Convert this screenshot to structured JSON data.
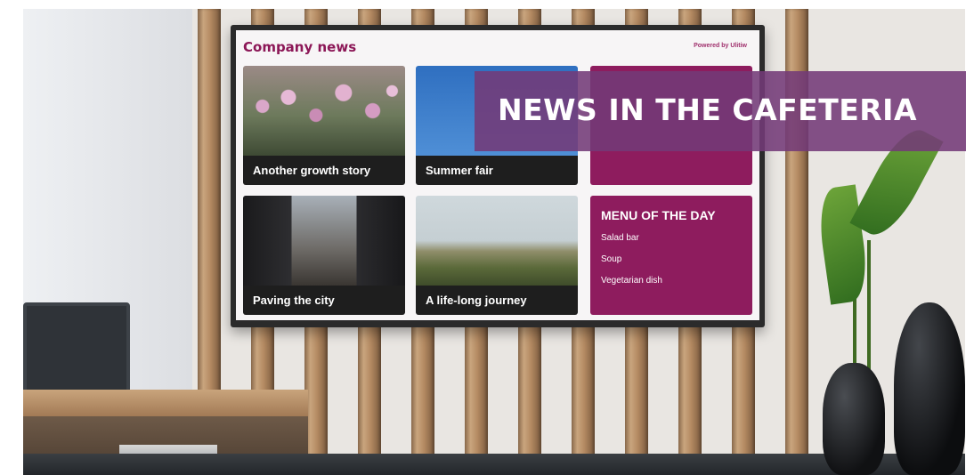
{
  "screen": {
    "brand": "Company news",
    "powered_by": "Powered by Ulitiw",
    "tiles": [
      {
        "caption": "Another growth story"
      },
      {
        "caption": "Summer fair"
      },
      {
        "caption": "Paving the city"
      },
      {
        "caption": "A life-long journey"
      }
    ],
    "menu": {
      "title": "MENU OF THE DAY",
      "items": [
        "Salad bar",
        "Soup",
        "Vegetarian dish"
      ]
    }
  },
  "banner": {
    "text": "NEWS IN THE CAFETERIA"
  },
  "colors": {
    "magenta": "#8e1c5e",
    "banner_purple": "#733a78",
    "caption_bg": "#1e1e1e"
  }
}
